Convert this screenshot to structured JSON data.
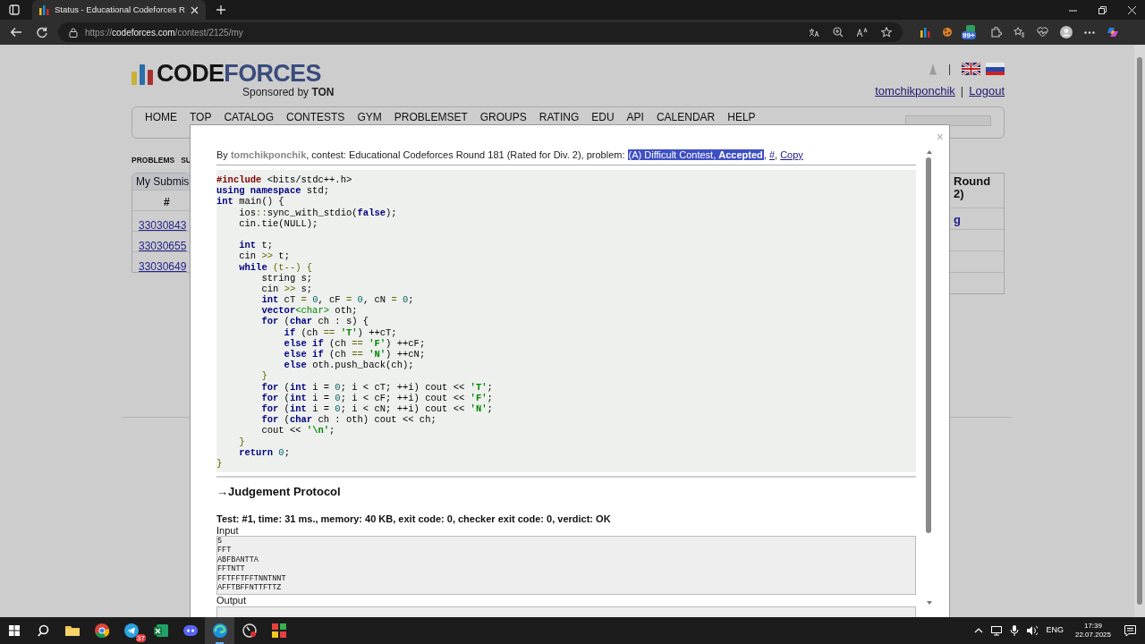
{
  "browser": {
    "tab_title": "Status - Educational Codeforces R",
    "url_scheme": "https://",
    "url_host": "codeforces.com",
    "url_path": "/contest/2125/my",
    "extension_badge": "99+"
  },
  "site": {
    "logo_code": "CODE",
    "logo_forces": "FORCES",
    "sponsor": "Sponsored by",
    "sponsor_name": "TON",
    "lang_separator": "|",
    "user": "tomchikponchik",
    "user_separator": "|",
    "logout": "Logout",
    "nav": [
      "HOME",
      "TOP",
      "CATALOG",
      "CONTESTS",
      "GYM",
      "PROBLEMSET",
      "GROUPS",
      "RATING",
      "EDU",
      "API",
      "CALENDAR",
      "HELP"
    ],
    "subnav": [
      "PROBLEMS",
      "SU"
    ],
    "submissions": {
      "title": "My Submis",
      "column": "#",
      "rows": [
        "33030843",
        "33030655",
        "33030649"
      ]
    },
    "side_table": {
      "title": "Round 2)",
      "link": "g"
    }
  },
  "modal": {
    "close": "×",
    "info": {
      "by": "By",
      "author": "tomchikponchik",
      "contest": ", contest: Educational Codeforces Round 181 (Rated for Div. 2), problem: ",
      "problem_link": "(A) Difficult Contest, **Accepted**",
      "problem_selected": true,
      "sep1": ", ",
      "hash_link": "#",
      "sep2": ", ",
      "copy_link": "Copy"
    },
    "code": [
      {
        "kind": "code",
        "tokens": [
          {
            "text": "#include",
            "kind": "pp"
          },
          {
            "text": " <bits/stdc++.h>",
            "kind": "pl"
          }
        ]
      },
      {
        "kind": "code",
        "tokens": [
          {
            "text": "using namespace",
            "kind": "kw"
          },
          {
            "text": " std;",
            "kind": "pl"
          }
        ]
      },
      {
        "kind": "code",
        "tokens": [
          {
            "text": "int",
            "kind": "kw"
          },
          {
            "text": " main() {",
            "kind": "pl"
          }
        ]
      },
      {
        "kind": "code",
        "tokens": [
          {
            "text": "    ios",
            "kind": "pl"
          },
          {
            "text": "::",
            "kind": "op"
          },
          {
            "text": "sync_with_stdio(",
            "kind": "pl"
          },
          {
            "text": "false",
            "kind": "kw"
          },
          {
            "text": ");",
            "kind": "pl"
          }
        ]
      },
      {
        "kind": "code",
        "tokens": [
          {
            "text": "    cin.tie(NULL);",
            "kind": "pl"
          }
        ]
      },
      {
        "kind": "blank"
      },
      {
        "kind": "code",
        "tokens": [
          {
            "text": "    int",
            "kind": "kw"
          },
          {
            "text": " t;",
            "kind": "pl"
          }
        ]
      },
      {
        "kind": "code",
        "tokens": [
          {
            "text": "    cin ",
            "kind": "pl"
          },
          {
            "text": ">>",
            "kind": "op"
          },
          {
            "text": " t;",
            "kind": "pl"
          }
        ]
      },
      {
        "kind": "code",
        "tokens": [
          {
            "text": "    while",
            "kind": "kw"
          },
          {
            "text": " (t--) {",
            "kind": "op"
          }
        ]
      },
      {
        "kind": "code",
        "tokens": [
          {
            "text": "        string s;",
            "kind": "pl"
          }
        ]
      },
      {
        "kind": "code",
        "tokens": [
          {
            "text": "        cin ",
            "kind": "pl"
          },
          {
            "text": ">>",
            "kind": "op"
          },
          {
            "text": " s;",
            "kind": "pl"
          }
        ]
      },
      {
        "kind": "code",
        "tokens": [
          {
            "text": "        int",
            "kind": "kw"
          },
          {
            "text": " cT ",
            "kind": "pl"
          },
          {
            "text": "=",
            "kind": "op"
          },
          {
            "text": " 0",
            "kind": "num"
          },
          {
            "text": ", cF ",
            "kind": "pl"
          },
          {
            "text": "=",
            "kind": "op"
          },
          {
            "text": " 0",
            "kind": "num"
          },
          {
            "text": ", cN ",
            "kind": "pl"
          },
          {
            "text": "=",
            "kind": "op"
          },
          {
            "text": " 0",
            "kind": "num"
          },
          {
            "text": ";",
            "kind": "pl"
          }
        ]
      },
      {
        "kind": "code",
        "tokens": [
          {
            "text": "        vector",
            "kind": "kw"
          },
          {
            "text": "<char>",
            "kind": "ty"
          },
          {
            "text": " oth;",
            "kind": "pl"
          }
        ]
      },
      {
        "kind": "code",
        "tokens": [
          {
            "text": "        for",
            "kind": "kw"
          },
          {
            "text": " (",
            "kind": "pl"
          },
          {
            "text": "char",
            "kind": "kw"
          },
          {
            "text": " ch : s) {",
            "kind": "pl"
          }
        ]
      },
      {
        "kind": "code",
        "tokens": [
          {
            "text": "            if",
            "kind": "kw"
          },
          {
            "text": " (ch ",
            "kind": "pl"
          },
          {
            "text": "==",
            "kind": "op"
          },
          {
            "text": " 'T'",
            "kind": "str"
          },
          {
            "text": ") ++cT;",
            "kind": "pl"
          }
        ]
      },
      {
        "kind": "code",
        "tokens": [
          {
            "text": "            else if",
            "kind": "kw"
          },
          {
            "text": " (ch ",
            "kind": "pl"
          },
          {
            "text": "==",
            "kind": "op"
          },
          {
            "text": " 'F'",
            "kind": "str"
          },
          {
            "text": ") ++cF;",
            "kind": "pl"
          }
        ]
      },
      {
        "kind": "code",
        "tokens": [
          {
            "text": "            else if",
            "kind": "kw"
          },
          {
            "text": " (ch ",
            "kind": "pl"
          },
          {
            "text": "==",
            "kind": "op"
          },
          {
            "text": " 'N'",
            "kind": "str"
          },
          {
            "text": ") ++cN;",
            "kind": "pl"
          }
        ]
      },
      {
        "kind": "code",
        "tokens": [
          {
            "text": "            else",
            "kind": "kw"
          },
          {
            "text": " oth.push_back(ch);",
            "kind": "pl"
          }
        ]
      },
      {
        "kind": "code",
        "tokens": [
          {
            "text": "        }",
            "kind": "op"
          }
        ]
      },
      {
        "kind": "code",
        "tokens": [
          {
            "text": "        for",
            "kind": "kw"
          },
          {
            "text": " (",
            "kind": "pl"
          },
          {
            "text": "int",
            "kind": "kw"
          },
          {
            "text": " i = ",
            "kind": "pl"
          },
          {
            "text": "0",
            "kind": "num"
          },
          {
            "text": "; i < cT; ++i) cout << ",
            "kind": "pl"
          },
          {
            "text": "'T'",
            "kind": "str"
          },
          {
            "text": ";",
            "kind": "pl"
          }
        ]
      },
      {
        "kind": "code",
        "tokens": [
          {
            "text": "        for",
            "kind": "kw"
          },
          {
            "text": " (",
            "kind": "pl"
          },
          {
            "text": "int",
            "kind": "kw"
          },
          {
            "text": " i = ",
            "kind": "pl"
          },
          {
            "text": "0",
            "kind": "num"
          },
          {
            "text": "; i < cF; ++i) cout << ",
            "kind": "pl"
          },
          {
            "text": "'F'",
            "kind": "str"
          },
          {
            "text": ";",
            "kind": "pl"
          }
        ]
      },
      {
        "kind": "code",
        "tokens": [
          {
            "text": "        for",
            "kind": "kw"
          },
          {
            "text": " (",
            "kind": "pl"
          },
          {
            "text": "int",
            "kind": "kw"
          },
          {
            "text": " i = ",
            "kind": "pl"
          },
          {
            "text": "0",
            "kind": "num"
          },
          {
            "text": "; i < cN; ++i) cout << ",
            "kind": "pl"
          },
          {
            "text": "'N'",
            "kind": "str"
          },
          {
            "text": ";",
            "kind": "pl"
          }
        ]
      },
      {
        "kind": "code",
        "tokens": [
          {
            "text": "        for",
            "kind": "kw"
          },
          {
            "text": " (",
            "kind": "pl"
          },
          {
            "text": "char",
            "kind": "kw"
          },
          {
            "text": " ch : oth) cout << ch;",
            "kind": "pl"
          }
        ]
      },
      {
        "kind": "code",
        "tokens": [
          {
            "text": "        cout << ",
            "kind": "pl"
          },
          {
            "text": "'\\n'",
            "kind": "str"
          },
          {
            "text": ";",
            "kind": "pl"
          }
        ]
      },
      {
        "kind": "code",
        "tokens": [
          {
            "text": "    }",
            "kind": "op"
          }
        ]
      },
      {
        "kind": "code",
        "tokens": [
          {
            "text": "    return",
            "kind": "kw"
          },
          {
            "text": " 0",
            "kind": "num"
          },
          {
            "text": ";",
            "kind": "pl"
          }
        ]
      },
      {
        "kind": "code",
        "tokens": [
          {
            "text": "}",
            "kind": "op"
          }
        ]
      }
    ],
    "protocol_title": "→Judgement Protocol",
    "test_summary": "Test: #1, time: 31 ms., memory: 40 KB, exit code: 0, checker exit code: 0, verdict: OK",
    "input_label": "Input",
    "input_lines": [
      "5",
      "FFT",
      "ABFBANTTA",
      "FFTNTT",
      "FFTFFTFFTNNTNNT",
      "AFFTBFFNTTFTTZ"
    ],
    "output_label": "Output"
  },
  "taskbar": {
    "apps": [
      {
        "kind": "folder",
        "active": false
      },
      {
        "kind": "chrome",
        "active": false
      },
      {
        "kind": "telegram",
        "active": false,
        "badge": "37"
      },
      {
        "kind": "excel",
        "active": false
      },
      {
        "kind": "discord",
        "active": false
      },
      {
        "kind": "edge",
        "active": true
      },
      {
        "kind": "gauge",
        "active": false
      },
      {
        "kind": "tiles",
        "active": false
      }
    ],
    "language": "ENG",
    "time": "17:39",
    "date": "22.07.2025"
  }
}
